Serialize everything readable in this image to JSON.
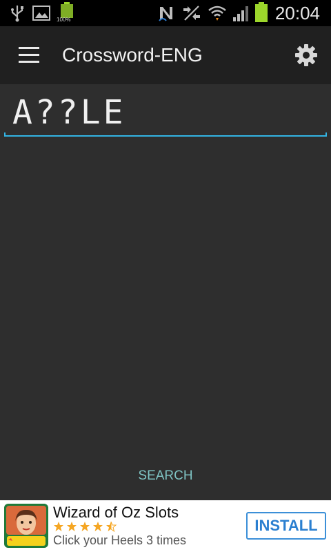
{
  "status_bar": {
    "time": "20:04",
    "battery_label": "100%",
    "icons": [
      "usb-icon",
      "image-icon",
      "battery-small-icon",
      "nfc-icon",
      "sync-off-icon",
      "wifi-icon",
      "signal-icon",
      "battery-icon"
    ],
    "battery_color": "#9cd62b"
  },
  "action_bar": {
    "title": "Crossword-ENG",
    "left_icon": "menu-icon",
    "right_icon": "settings-gear-icon"
  },
  "search": {
    "input_value": "A??LE",
    "button_label": "SEARCH",
    "accent_color": "#33b5e5"
  },
  "ad": {
    "title": "Wizard of Oz Slots",
    "subtitle": "Click your Heels 3 times",
    "rating": 4.5,
    "rating_max": 5,
    "install_label": "INSTALL",
    "thumb_label": "SLOTS"
  }
}
